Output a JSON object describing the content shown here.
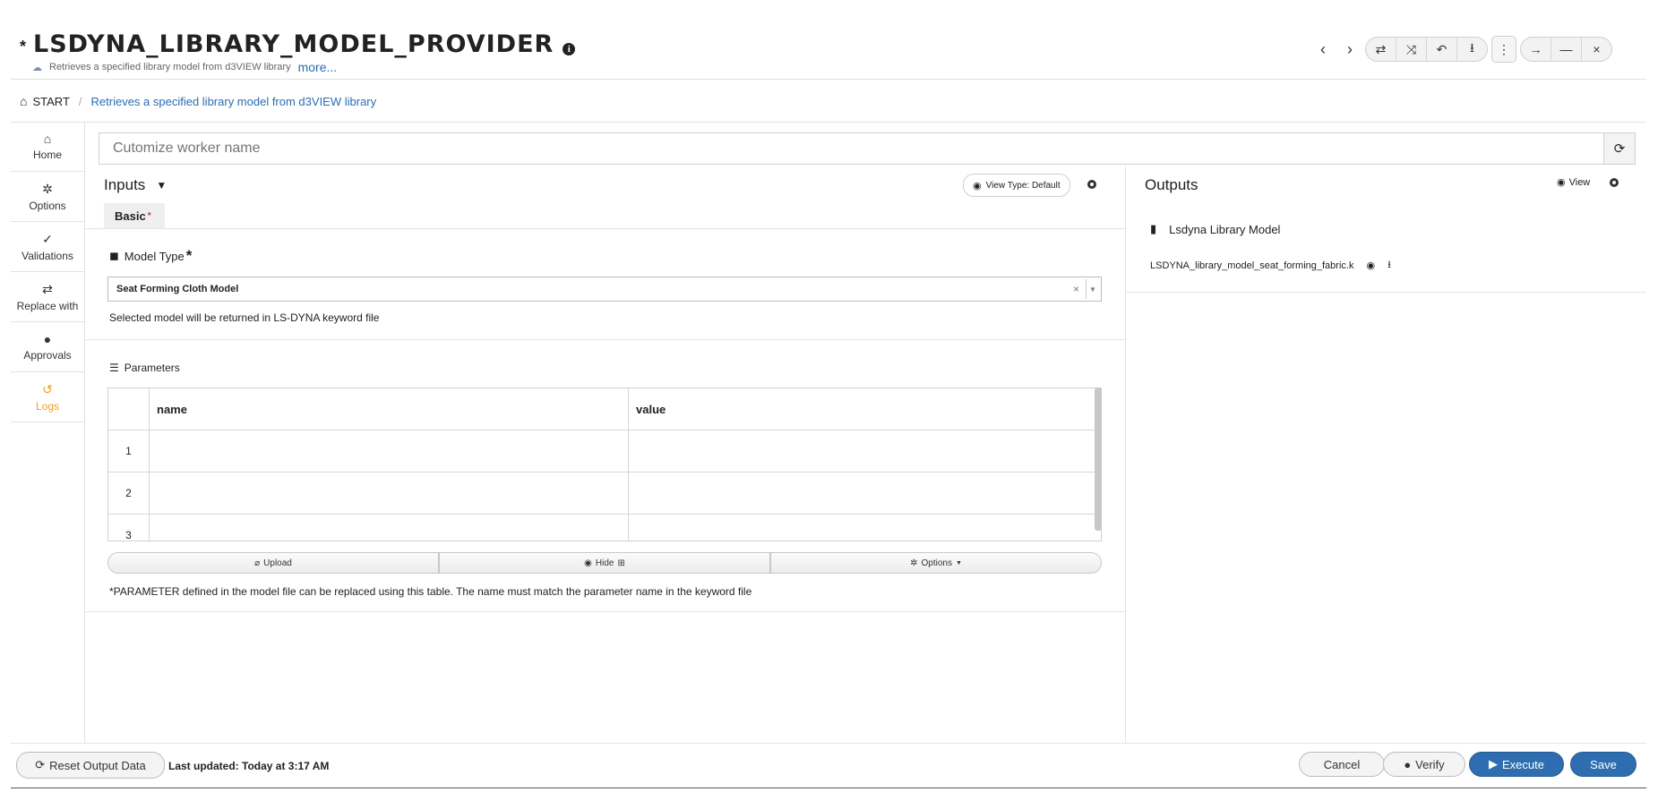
{
  "header": {
    "modified_marker": "*",
    "title": "LSDYNA_LIBRARY_MODEL_PROVIDER",
    "subtitle": "Retrieves a specified library model from d3VIEW library",
    "more_link": "more..."
  },
  "window_controls": {
    "icons": [
      "chevron-left-icon",
      "chevron-right-icon",
      "swap-icon",
      "shuffle-icon",
      "undo-icon",
      "download-icon",
      "kebab-menu-icon",
      "arrow-right-icon",
      "minimize-icon",
      "close-icon"
    ]
  },
  "breadcrumb": {
    "home": "START",
    "current": "Retrieves a specified library model from d3VIEW library"
  },
  "left_nav": {
    "items": [
      {
        "label": "Home",
        "icon": "home-icon"
      },
      {
        "label": "Options",
        "icon": "gear-icon"
      },
      {
        "label": "Validations",
        "icon": "check-icon"
      },
      {
        "label": "Replace with",
        "icon": "swap-icon"
      },
      {
        "label": "Approvals",
        "icon": "user-check-icon"
      },
      {
        "label": "Logs",
        "icon": "history-icon",
        "active": true
      }
    ]
  },
  "worker_name": {
    "placeholder": "Cutomize worker name",
    "value": ""
  },
  "inputs": {
    "title": "Inputs",
    "view_type_label": "View Type: Default",
    "tabs": [
      {
        "label": "Basic",
        "required_marker": "*"
      }
    ],
    "model_type": {
      "label": "Model Type",
      "required_marker": "*",
      "selected": "Seat Forming Cloth Model",
      "clear_glyph": "×",
      "help": "Selected model will be returned in LS-DYNA keyword file"
    },
    "parameters": {
      "label": "Parameters",
      "columns": [
        "name",
        "value"
      ],
      "rows": [
        {
          "index": "1",
          "name": "",
          "value": ""
        },
        {
          "index": "2",
          "name": "",
          "value": ""
        },
        {
          "index": "3",
          "name": "",
          "value": ""
        }
      ],
      "actions": {
        "upload": "Upload",
        "hide": "Hide",
        "options": "Options"
      },
      "note": "*PARAMETER defined in the model file can be replaced using this table. The name must match the parameter name in the keyword file"
    }
  },
  "outputs": {
    "title": "Outputs",
    "view_label": "View",
    "section_label": "Lsdyna Library Model",
    "file_name": "LSDYNA_library_model_seat_forming_fabric.k"
  },
  "footer": {
    "reset_label": "Reset Output Data",
    "last_updated": "Last updated: Today at 3:17 AM",
    "cancel_label": "Cancel",
    "verify_label": "Verify",
    "execute_label": "Execute",
    "save_label": "Save"
  }
}
